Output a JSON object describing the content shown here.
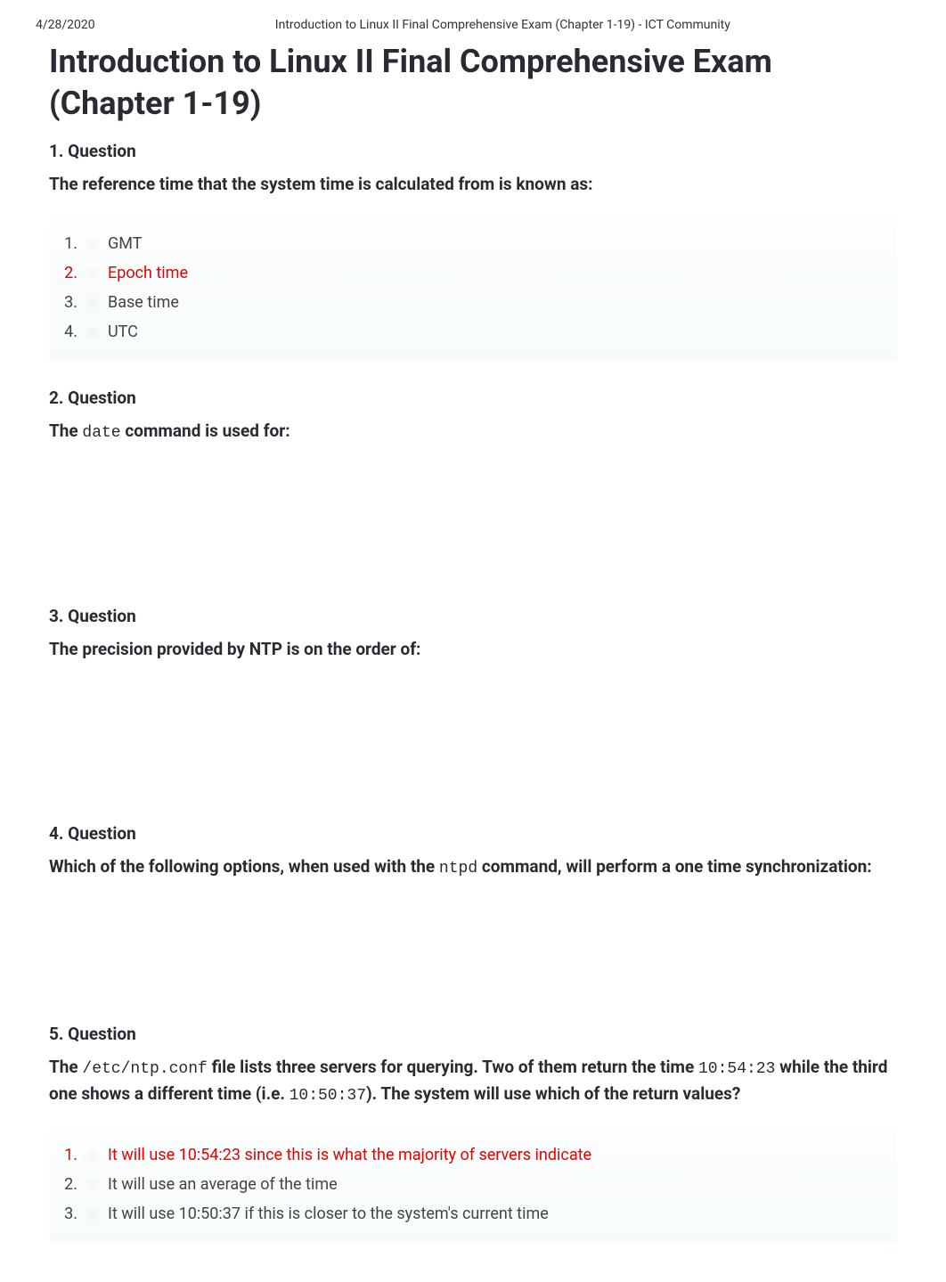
{
  "header": {
    "date": "4/28/2020",
    "doc_title": "Introduction to Linux II Final Comprehensive Exam (Chapter 1-19) - ICT Community"
  },
  "page_title": "Introduction to Linux II Final Comprehensive Exam (Chapter 1-19)",
  "q1": {
    "heading": "1. Question",
    "text": "The reference time that the system time is calculated from is known as:",
    "options": {
      "n1": "1.",
      "o1": "GMT",
      "n2": "2.",
      "o2": "Epoch time",
      "n3": "3.",
      "o3": "Base time",
      "n4": "4.",
      "o4": "UTC"
    }
  },
  "q2": {
    "heading": "2. Question",
    "text_pre": "The ",
    "text_mono": "date",
    "text_post": " command is used for:"
  },
  "q3": {
    "heading": "3. Question",
    "text": "The precision provided by NTP is on the order of:"
  },
  "q4": {
    "heading": "4. Question",
    "text_pre": "Which of the following options, when used with the ",
    "text_mono": "ntpd",
    "text_post": " command, will perform a one time synchronization:"
  },
  "q5": {
    "heading": "5. Question",
    "text_pre": "The ",
    "text_mono1": "/etc/ntp.conf",
    "text_mid1": " file lists three servers for querying. Two of them return the time ",
    "text_mono2": "10:54:23",
    "text_mid2": " while the third one shows a different time (i.e. ",
    "text_mono3": "10:50:37",
    "text_post": "). The system will use which of the return values?",
    "options": {
      "n1": "1.",
      "o1": "It will use 10:54:23 since this is what the majority of servers indicate",
      "n2": "2.",
      "o2": "It will use an average of the time",
      "n3": "3.",
      "o3": "It will use 10:50:37 if this is closer to the system's current time"
    }
  }
}
